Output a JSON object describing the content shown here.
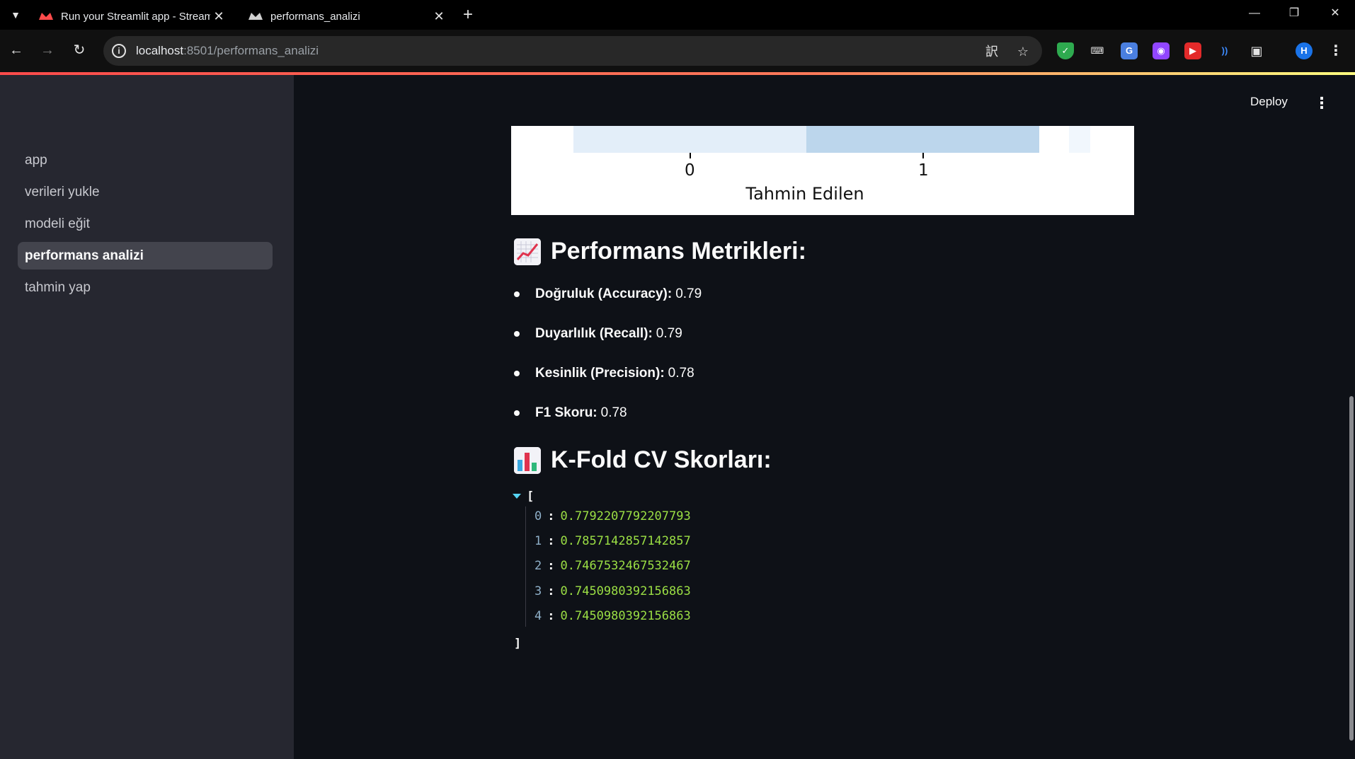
{
  "browser": {
    "tabs": [
      {
        "title": "Run your Streamlit app - Stream",
        "active": false
      },
      {
        "title": "performans_analizi",
        "active": true
      }
    ],
    "url_host": "localhost",
    "url_path": ":8501/performans_analizi",
    "profile_initial": "H"
  },
  "sidebar": {
    "items": [
      {
        "label": "app",
        "active": false
      },
      {
        "label": "verileri yukle",
        "active": false
      },
      {
        "label": "modeli eğit",
        "active": false
      },
      {
        "label": "performans analizi",
        "active": true
      },
      {
        "label": "tahmin yap",
        "active": false
      }
    ]
  },
  "header": {
    "deploy_label": "Deploy"
  },
  "confusion_matrix": {
    "x_ticks": [
      "0",
      "1"
    ],
    "x_label": "Tahmin Edilen",
    "colors": [
      "#e3eef9",
      "#bcd6ec",
      "#f1f7fd"
    ]
  },
  "metrics_section": {
    "title": "Performans Metrikleri:",
    "icon": "chart-increasing-emoji",
    "items": [
      {
        "label": "Doğruluk (Accuracy):",
        "value": "0.79"
      },
      {
        "label": "Duyarlılık (Recall):",
        "value": "0.79"
      },
      {
        "label": "Kesinlik (Precision):",
        "value": "0.78"
      },
      {
        "label": "F1 Skoru:",
        "value": "0.78"
      }
    ]
  },
  "kfold_section": {
    "title": "K-Fold CV Skorları:",
    "icon": "bar-chart-emoji",
    "open_bracket": "[",
    "close_bracket": "]",
    "scores": [
      {
        "index": "0",
        "value": "0.7792207792207793"
      },
      {
        "index": "1",
        "value": "0.7857142857142857"
      },
      {
        "index": "2",
        "value": "0.7467532467532467"
      },
      {
        "index": "3",
        "value": "0.7450980392156863"
      },
      {
        "index": "4",
        "value": "0.7450980392156863"
      }
    ]
  }
}
